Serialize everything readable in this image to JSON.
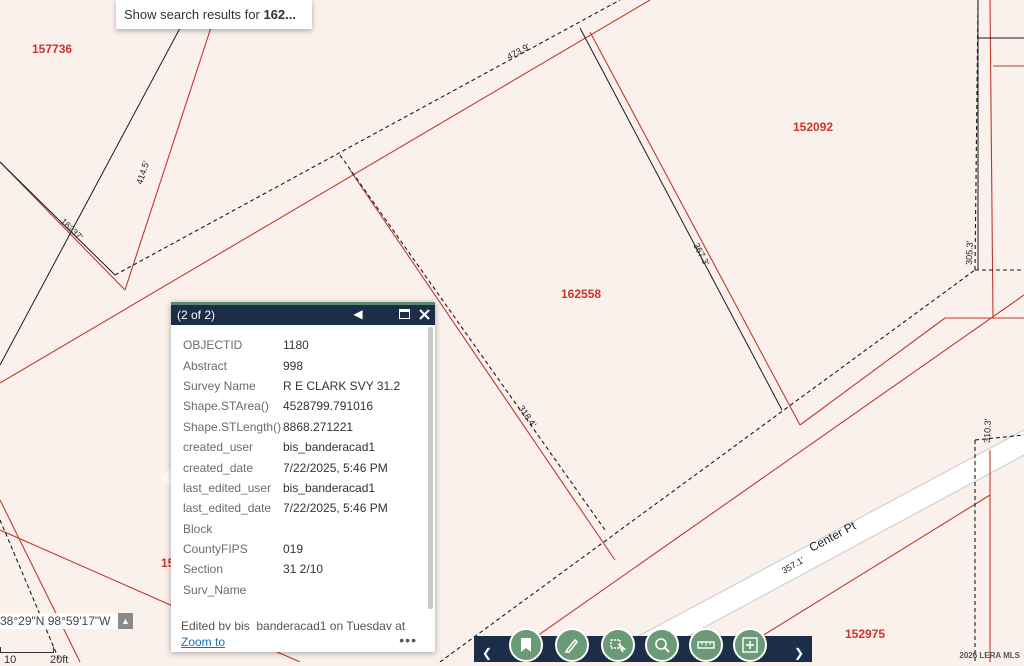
{
  "search": {
    "prefix": "Show search results for ",
    "term": "162..."
  },
  "parcels": [
    {
      "id": "157736"
    },
    {
      "id": "152092"
    },
    {
      "id": "162558"
    },
    {
      "id": "152975"
    },
    {
      "id": "15"
    }
  ],
  "dimensions": [
    "473.9'",
    "414.5'",
    "16237'",
    "305.3'",
    "367.3'",
    "318.4'",
    "310.3'",
    "357.1'"
  ],
  "road": {
    "name": "Center Pt"
  },
  "popup": {
    "header": "(2 of 2)",
    "fields": [
      {
        "key": "OBJECTID",
        "value": "1180"
      },
      {
        "key": "Abstract",
        "value": "998"
      },
      {
        "key": "Survey Name",
        "value": "R E CLARK SVY 31.2"
      },
      {
        "key": "Shape.STArea()",
        "value": "4528799.791016"
      },
      {
        "key": "Shape.STLength()",
        "value": "8868.271221"
      },
      {
        "key": "created_user",
        "value": "bis_banderacad1"
      },
      {
        "key": "created_date",
        "value": "7/22/2025, 5:46 PM"
      },
      {
        "key": "last_edited_user",
        "value": "bis_banderacad1"
      },
      {
        "key": "last_edited_date",
        "value": "7/22/2025, 5:46 PM"
      },
      {
        "key": "Block",
        "value": ""
      },
      {
        "key": "CountyFIPS",
        "value": "019"
      },
      {
        "key": "Section",
        "value": "31 2/10"
      },
      {
        "key": "Surv_Name",
        "value": ""
      }
    ],
    "edited_note": "Edited by bis_banderacad1 on Tuesday at",
    "zoom_label": "Zoom to",
    "more_label": "•••"
  },
  "coords": {
    "text": "38°29\"N 98°59'17\"W"
  },
  "scale": {
    "left": "10",
    "right": "20ft"
  },
  "toolbar": {
    "tools": [
      {
        "icon": "bookmark-icon"
      },
      {
        "icon": "draw-icon"
      },
      {
        "icon": "select-icon"
      },
      {
        "icon": "search-zoom-icon"
      },
      {
        "icon": "measure-icon"
      },
      {
        "icon": "add-data-icon"
      }
    ]
  },
  "watermark": "2026 LERA MLS",
  "colors": {
    "map_bg": "#fbf1ec",
    "parcel_line": "#c0392b",
    "label_red": "#d1332a",
    "popup_header": "#1c2e47",
    "tool_green": "#6b9a77"
  }
}
